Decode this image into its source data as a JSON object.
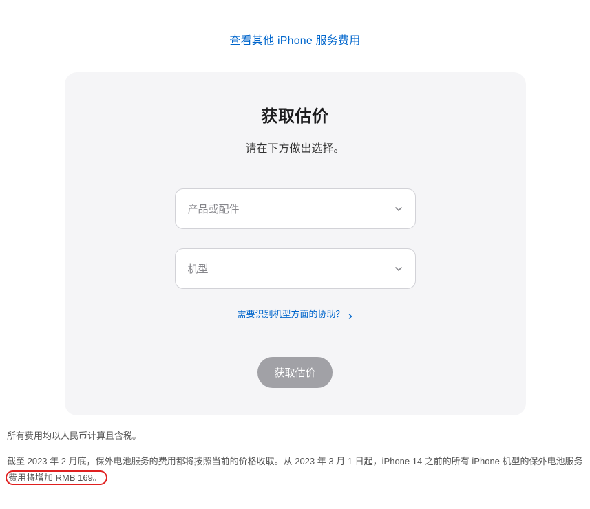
{
  "topLink": "查看其他 iPhone 服务费用",
  "card": {
    "title": "获取估价",
    "subtitle": "请在下方做出选择。",
    "select1": {
      "placeholder": "产品或配件"
    },
    "select2": {
      "placeholder": "机型"
    },
    "helpLink": "需要识别机型方面的协助？",
    "submit": "获取估价"
  },
  "footnote1": "所有费用均以人民币计算且含税。",
  "footnote2_part1": "截至 2023 年 2 月底，保外电池服务的费用都将按照当前的价格收取。从 2023 年 3 月 1 日起，iPhone 14 之前的所有 iPhone 机型的保外电池服务",
  "footnote2_highlight": "费用将增加 RMB 169。"
}
